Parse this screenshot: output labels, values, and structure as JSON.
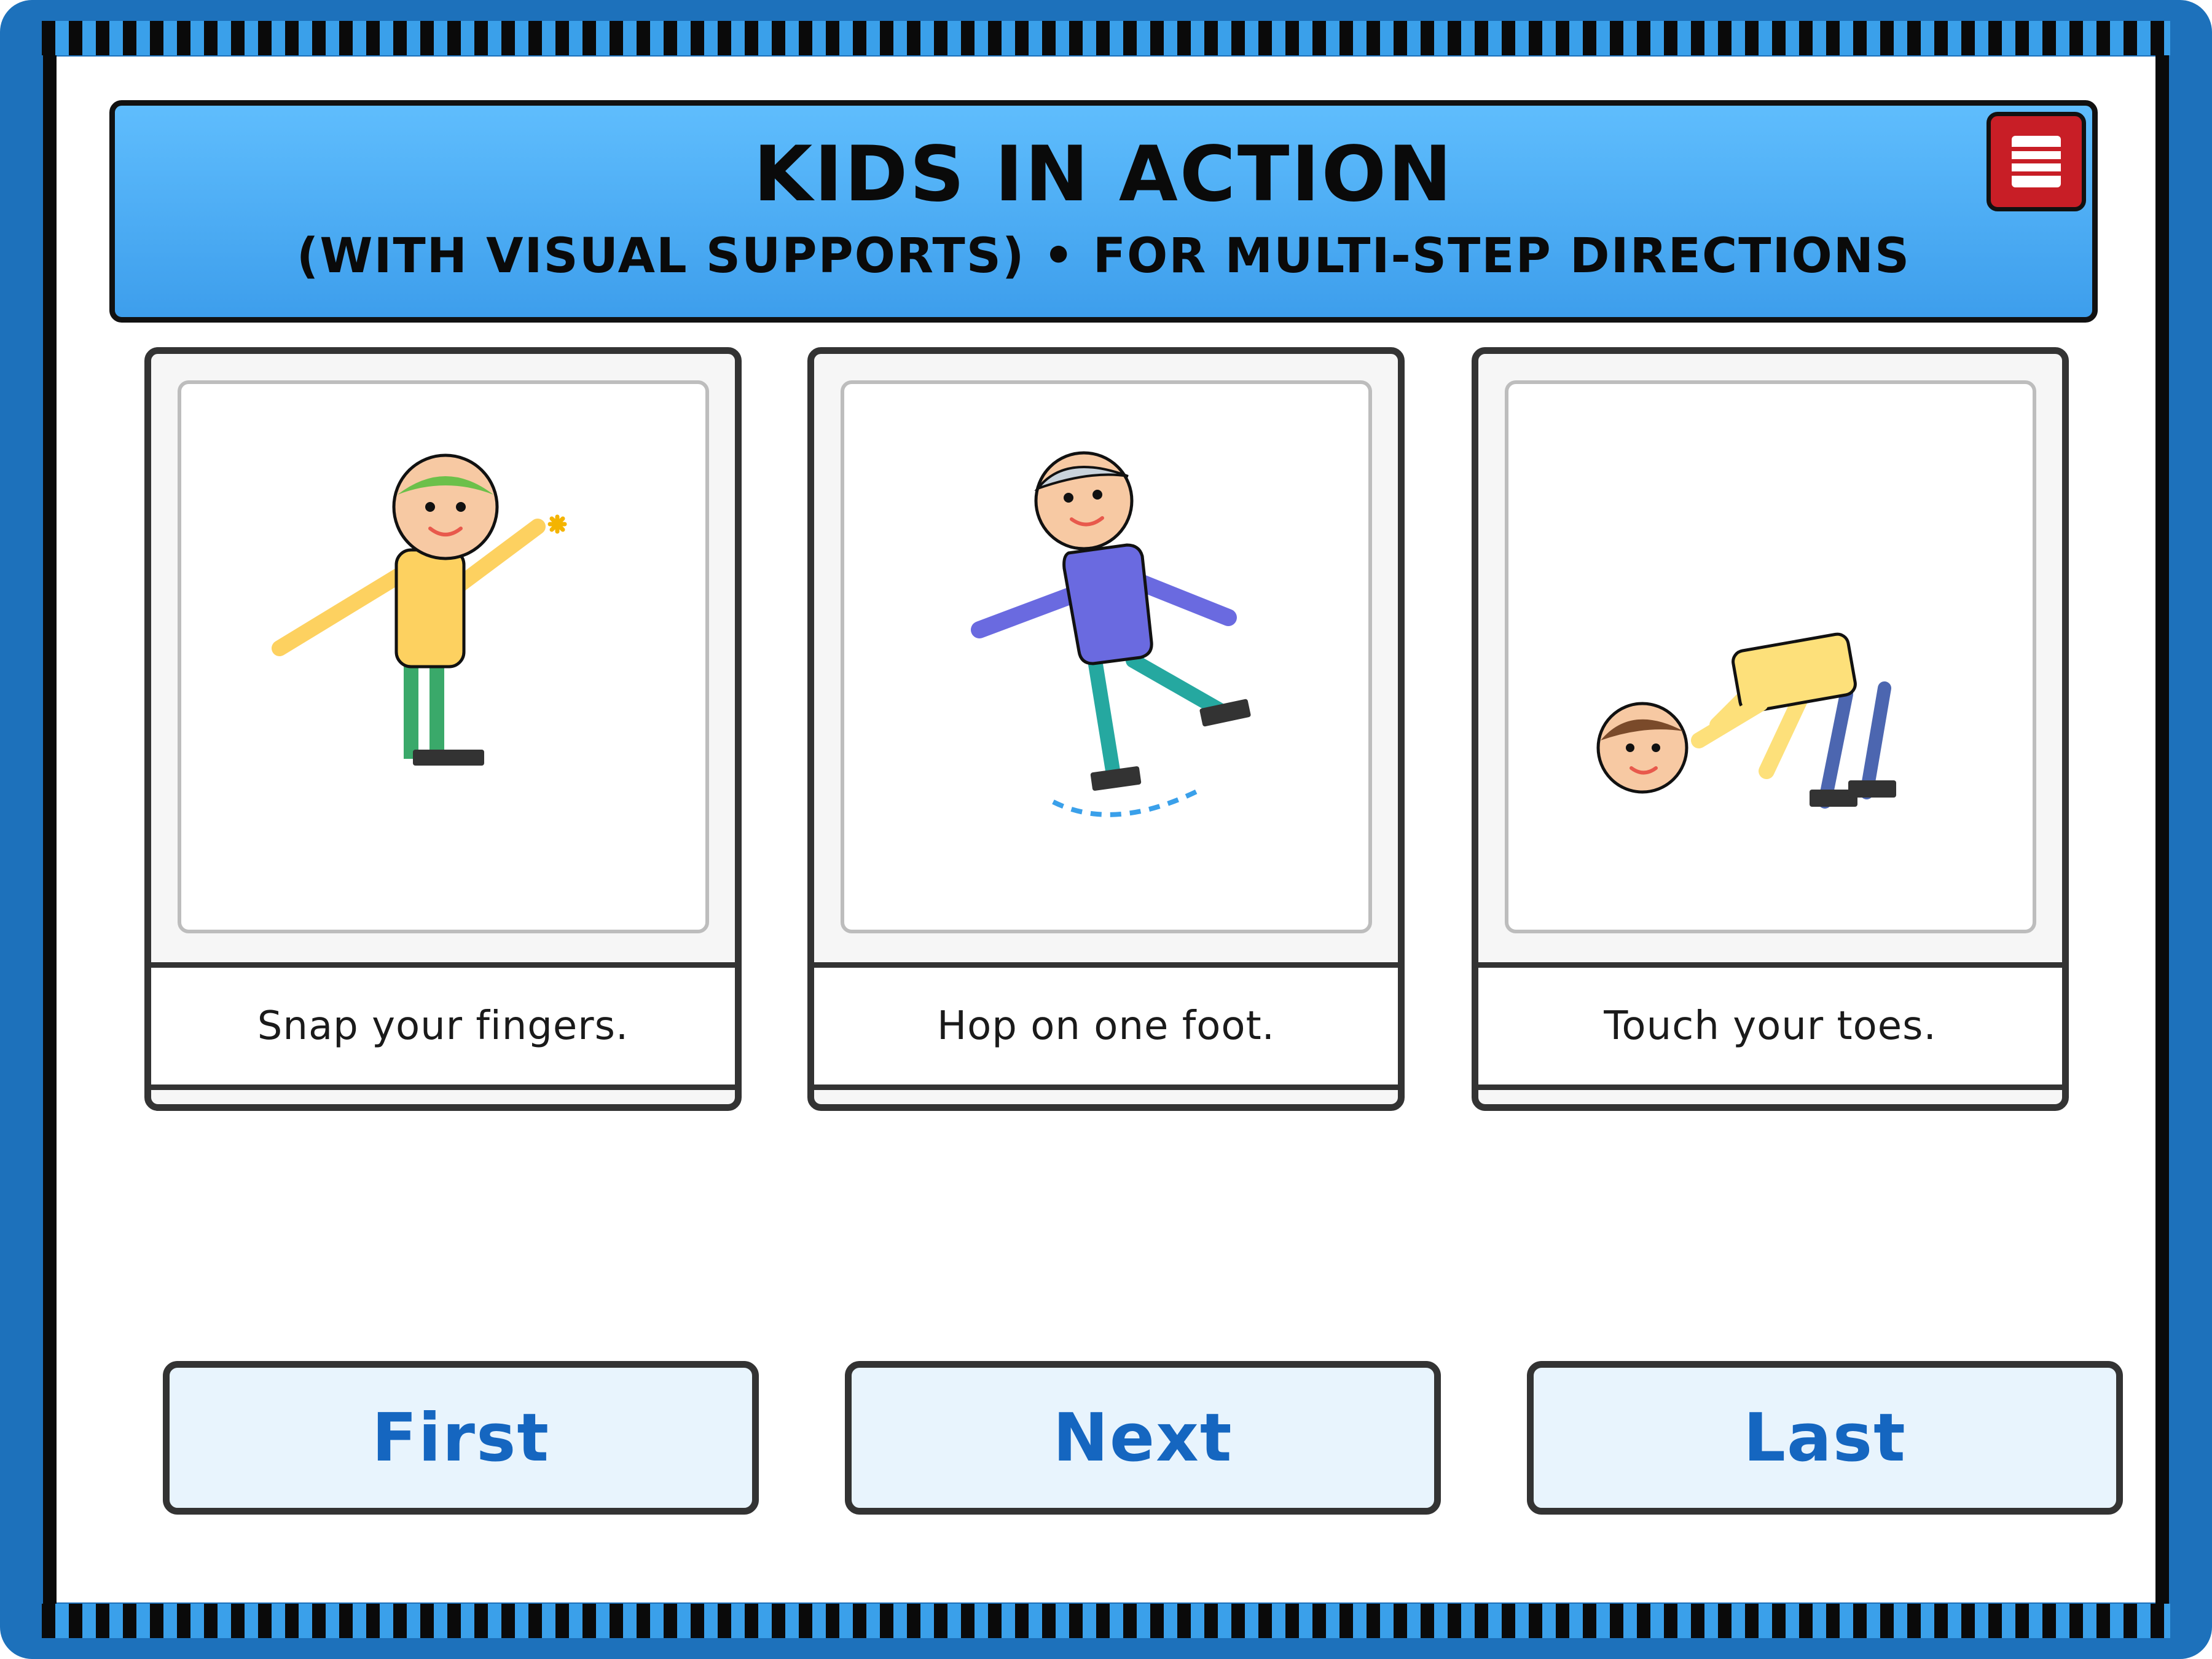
{
  "header": {
    "title": "KIDS IN ACTION",
    "subtitle": "(WITH VISUAL SUPPORTS) • FOR MULTI-STEP DIRECTIONS",
    "menu_icon": "menu-icon"
  },
  "cards": [
    {
      "caption": "Snap your fingers.",
      "illustration": "child-snapping-fingers-icon"
    },
    {
      "caption": "Hop on one foot.",
      "illustration": "child-hopping-icon"
    },
    {
      "caption": "Touch your toes.",
      "illustration": "child-touching-toes-icon"
    }
  ],
  "nav": {
    "first_label": "First",
    "next_label": "Next",
    "last_label": "Last"
  },
  "colors": {
    "frame": "#1d71bb",
    "header_top": "#5fbdfd",
    "header_bottom": "#3d9eec",
    "menu_button": "#c81e26",
    "nav_text": "#1566c0",
    "nav_bg": "#e8f4fd"
  }
}
